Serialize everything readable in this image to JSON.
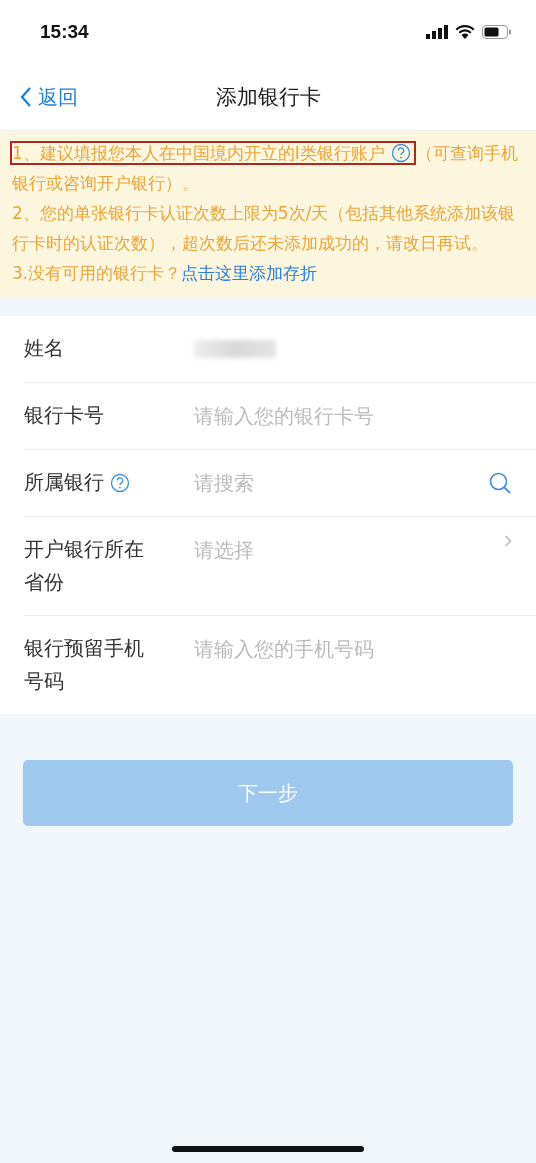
{
  "status_bar": {
    "time": "15:34"
  },
  "nav": {
    "back": "返回",
    "title": "添加银行卡"
  },
  "notice": [
    {
      "highlighted": "1、建议填报您本人在中国境内开立的Ⅰ类银行账户",
      "help": true,
      "text": "（可查询手机银行或咨询开户银行）。"
    },
    {
      "text": "2、您的单张银行卡认证次数上限为5次/天（包括其他系统添加该银行卡时的认证次数），超次数后还未添加成功的，请改日再试。"
    },
    {
      "text": "3.没有可用的银行卡？",
      "link": "点击这里添加存折"
    }
  ],
  "form": [
    {
      "label": "姓名",
      "kind": "redacted",
      "help": false
    },
    {
      "label": "银行卡号",
      "kind": "input",
      "placeholder": "请输入您的银行卡号",
      "help": false
    },
    {
      "label": "所属银行",
      "kind": "search",
      "placeholder": "请搜索",
      "help": true
    },
    {
      "label": "开户银行所在省份",
      "kind": "select",
      "placeholder": "请选择",
      "help": false
    },
    {
      "label": "银行预留手机号码",
      "kind": "input",
      "placeholder": "请输入您的手机号码",
      "help": false
    }
  ],
  "next_button": {
    "label": "下一步",
    "disabled": true
  }
}
